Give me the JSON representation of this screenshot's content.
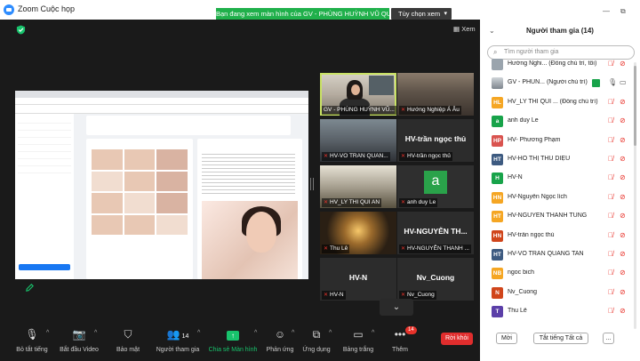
{
  "window": {
    "title": "Zoom Cuộc họp",
    "share_banner": "Bạn đang xem màn hình của GV - PHÙNG HUỲNH VŨ QUÂN",
    "view_options": "Tùy chọn xem",
    "view_label": "Xem"
  },
  "colors": {
    "accent": "#2d8cff",
    "share_green": "#20b04b",
    "muted_red": "#e8322a",
    "leave_red": "#e02d2d",
    "tile_border": "#c9e265"
  },
  "tiles": [
    {
      "name": "",
      "label": "GV - PHÙNG HUỲNH VŨ...",
      "muted": false,
      "kind": "photo-gv",
      "active": true
    },
    {
      "name": "",
      "label": "Hướng Nghiệp Á Âu",
      "muted": true,
      "kind": "photo-room"
    },
    {
      "name": "",
      "label": "HV-VO TRAN QUAN...",
      "muted": true,
      "kind": "photo-room2"
    },
    {
      "name": "HV-trần ngọc thủ",
      "label": "HV-trần ngọc thủ",
      "muted": true,
      "kind": "name"
    },
    {
      "name": "",
      "label": "HV_LY THI QUI AN",
      "muted": true,
      "kind": "photo-desk"
    },
    {
      "name": "",
      "label": "anh duy Le",
      "muted": true,
      "kind": "avatar",
      "initial": "a"
    },
    {
      "name": "",
      "label": "Thu Lê",
      "muted": true,
      "kind": "photo-lamp"
    },
    {
      "name": "HV-NGUYỄN TH...",
      "label": "HV-NGUYỄN THANH ...",
      "muted": true,
      "kind": "name"
    },
    {
      "name": "HV-N",
      "label": "HV-N",
      "muted": true,
      "kind": "name"
    },
    {
      "name": "Nv_Cuong",
      "label": "Nv_Cuong",
      "muted": true,
      "kind": "name"
    }
  ],
  "toolbar": {
    "mute": "Bỏ tắt tiếng",
    "video": "Bắt đầu Video",
    "security": "Bảo mật",
    "participants": "Người tham gia",
    "participants_count": "14",
    "share": "Chia sẻ Màn hình",
    "reactions": "Phản ứng",
    "apps": "Ứng dụng",
    "whiteboard": "Bảng trắng",
    "more": "Thêm",
    "more_badge": "14",
    "leave": "Rời khỏi"
  },
  "panel": {
    "title": "Người tham gia (14)",
    "search_placeholder": "Tìm người tham gia",
    "participants": [
      {
        "initials": "",
        "avatar": "#9aa4ad",
        "name": "Hướng Nghi...  (Đồng chủ trì, tôi)",
        "mic": "muted",
        "cam": "off"
      },
      {
        "initials": "",
        "avatar": "photo",
        "name": "GV - PHÙN...  (Người chủ trì)",
        "mic": "on",
        "cam": "on",
        "sharing": true
      },
      {
        "initials": "HL",
        "avatar": "#f5a623",
        "name": "HV_LY THI QUI ...  (Đồng chủ trì)",
        "mic": "muted",
        "cam": "off"
      },
      {
        "initials": "a",
        "avatar": "#18a34a",
        "name": "anh duy Le",
        "mic": "muted",
        "cam": "off"
      },
      {
        "initials": "HP",
        "avatar": "#d9534f",
        "name": "HV- Phương Phạm",
        "mic": "muted",
        "cam": "off"
      },
      {
        "initials": "HT",
        "avatar": "#3d5a80",
        "name": "HV-HỒ THỊ THU DIỆU",
        "mic": "muted",
        "cam": "off"
      },
      {
        "initials": "H",
        "avatar": "#18a34a",
        "name": "HV-N",
        "mic": "muted",
        "cam": "off"
      },
      {
        "initials": "HN",
        "avatar": "#f5a623",
        "name": "HV-Nguyễn Ngọc lích",
        "mic": "muted",
        "cam": "off"
      },
      {
        "initials": "HT",
        "avatar": "#f5a623",
        "name": "HV-NGUYỄN THANH TÙNG",
        "mic": "muted",
        "cam": "off"
      },
      {
        "initials": "HN",
        "avatar": "#d0451b",
        "name": "HV-trần ngọc thủ",
        "mic": "muted",
        "cam": "off"
      },
      {
        "initials": "HT",
        "avatar": "#3d5a80",
        "name": "HV-VO TRAN QUANG TAN",
        "mic": "muted",
        "cam": "off"
      },
      {
        "initials": "NB",
        "avatar": "#f5a623",
        "name": "ngoc bich",
        "mic": "muted",
        "cam": "off"
      },
      {
        "initials": "N",
        "avatar": "#d0451b",
        "name": "Nv_Cuong",
        "mic": "muted",
        "cam": "off"
      },
      {
        "initials": "T",
        "avatar": "#5b3fa8",
        "name": "Thu Lê",
        "mic": "muted",
        "cam": "off"
      }
    ],
    "invite": "Mời",
    "mute_all": "Tắt tiếng Tất cả",
    "more": "..."
  }
}
